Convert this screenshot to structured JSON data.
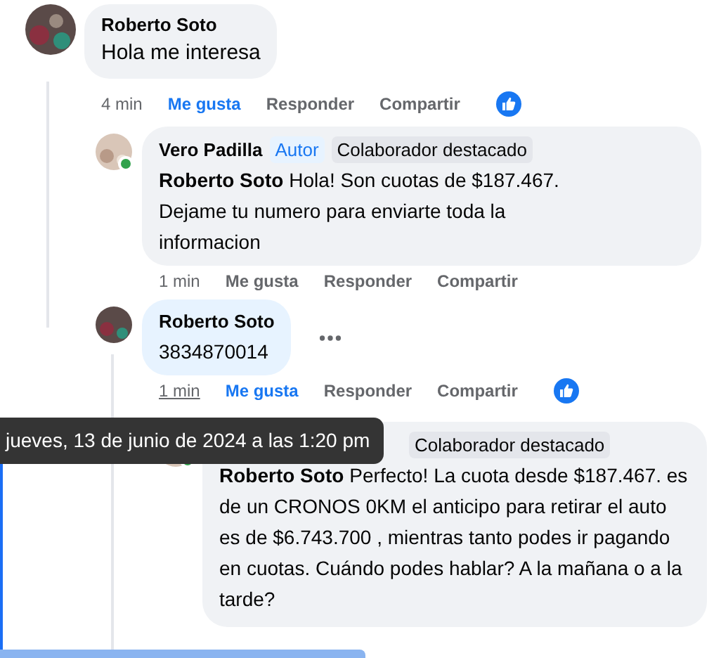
{
  "comments": [
    {
      "author": "Roberto Soto",
      "text": "Hola me interesa",
      "time": "4 min",
      "like": "Me gusta",
      "liked": true,
      "reply": "Responder",
      "share": "Compartir",
      "reaction_shown": true,
      "children": [
        {
          "author": "Vero Padilla",
          "author_tag": "Autor",
          "badge": "Colaborador destacado",
          "mention": "Roberto Soto",
          "text": "Hola! Son cuotas de $187.467.\nDejame tu numero para enviarte toda la\ninformacion",
          "time": "1 min",
          "like": "Me gusta",
          "liked": false,
          "reply": "Responder",
          "share": "Compartir",
          "online": true
        },
        {
          "author": "Roberto Soto",
          "text": "3834870014",
          "time": "1 min",
          "time_hovered": true,
          "like": "Me gusta",
          "liked": true,
          "reply": "Responder",
          "share": "Compartir",
          "reaction_shown": true,
          "own": true,
          "menu_shown": true,
          "children": [
            {
              "badge": "Colaborador destacado",
              "mention": "Roberto Soto",
              "text": "Perfecto! La cuota desde $187.467. es de un CRONOS 0KM el anticipo para retirar el auto es de $6.743.700 , mientras tanto podes ir pagando en cuotas. Cuándo podes hablar? A la mañana o a la tarde?",
              "online": true
            }
          ]
        }
      ]
    }
  ],
  "tooltip": {
    "text": "jueves, 13 de junio de 2024 a las 1:20 pm"
  }
}
